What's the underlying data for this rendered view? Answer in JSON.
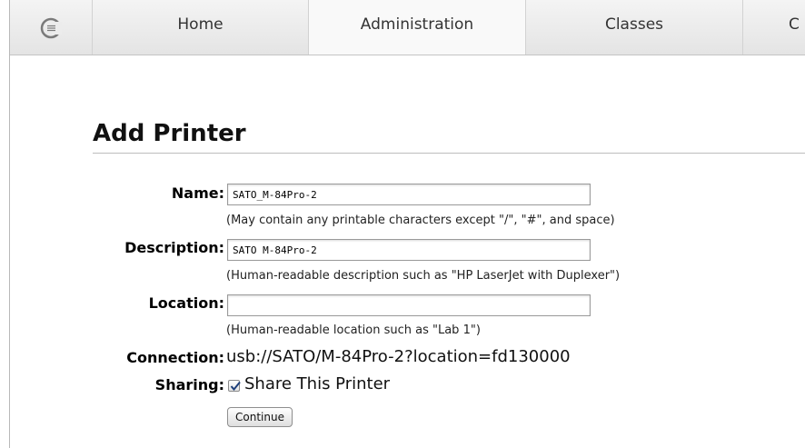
{
  "nav": {
    "items": [
      {
        "label": "Home",
        "active": false
      },
      {
        "label": "Administration",
        "active": true
      },
      {
        "label": "Classes",
        "active": false
      },
      {
        "label": "C",
        "active": false
      }
    ]
  },
  "page": {
    "title": "Add Printer"
  },
  "form": {
    "name": {
      "label": "Name:",
      "value": "SATO_M-84Pro-2",
      "hint": "(May contain any printable characters except \"/\", \"#\", and space)"
    },
    "description": {
      "label": "Description:",
      "value": "SATO M-84Pro-2",
      "hint": "(Human-readable description such as \"HP LaserJet with Duplexer\")"
    },
    "location": {
      "label": "Location:",
      "value": "",
      "hint": "(Human-readable location such as \"Lab 1\")"
    },
    "connection": {
      "label": "Connection:",
      "value": "usb://SATO/M-84Pro-2?location=fd130000"
    },
    "sharing": {
      "label": "Sharing:",
      "checkbox_label": "Share This Printer",
      "checked": true
    },
    "continue_label": "Continue"
  },
  "colors": {
    "navbar_bg": "#e8e8e8",
    "active_tab_bg": "#f9f9f9"
  }
}
